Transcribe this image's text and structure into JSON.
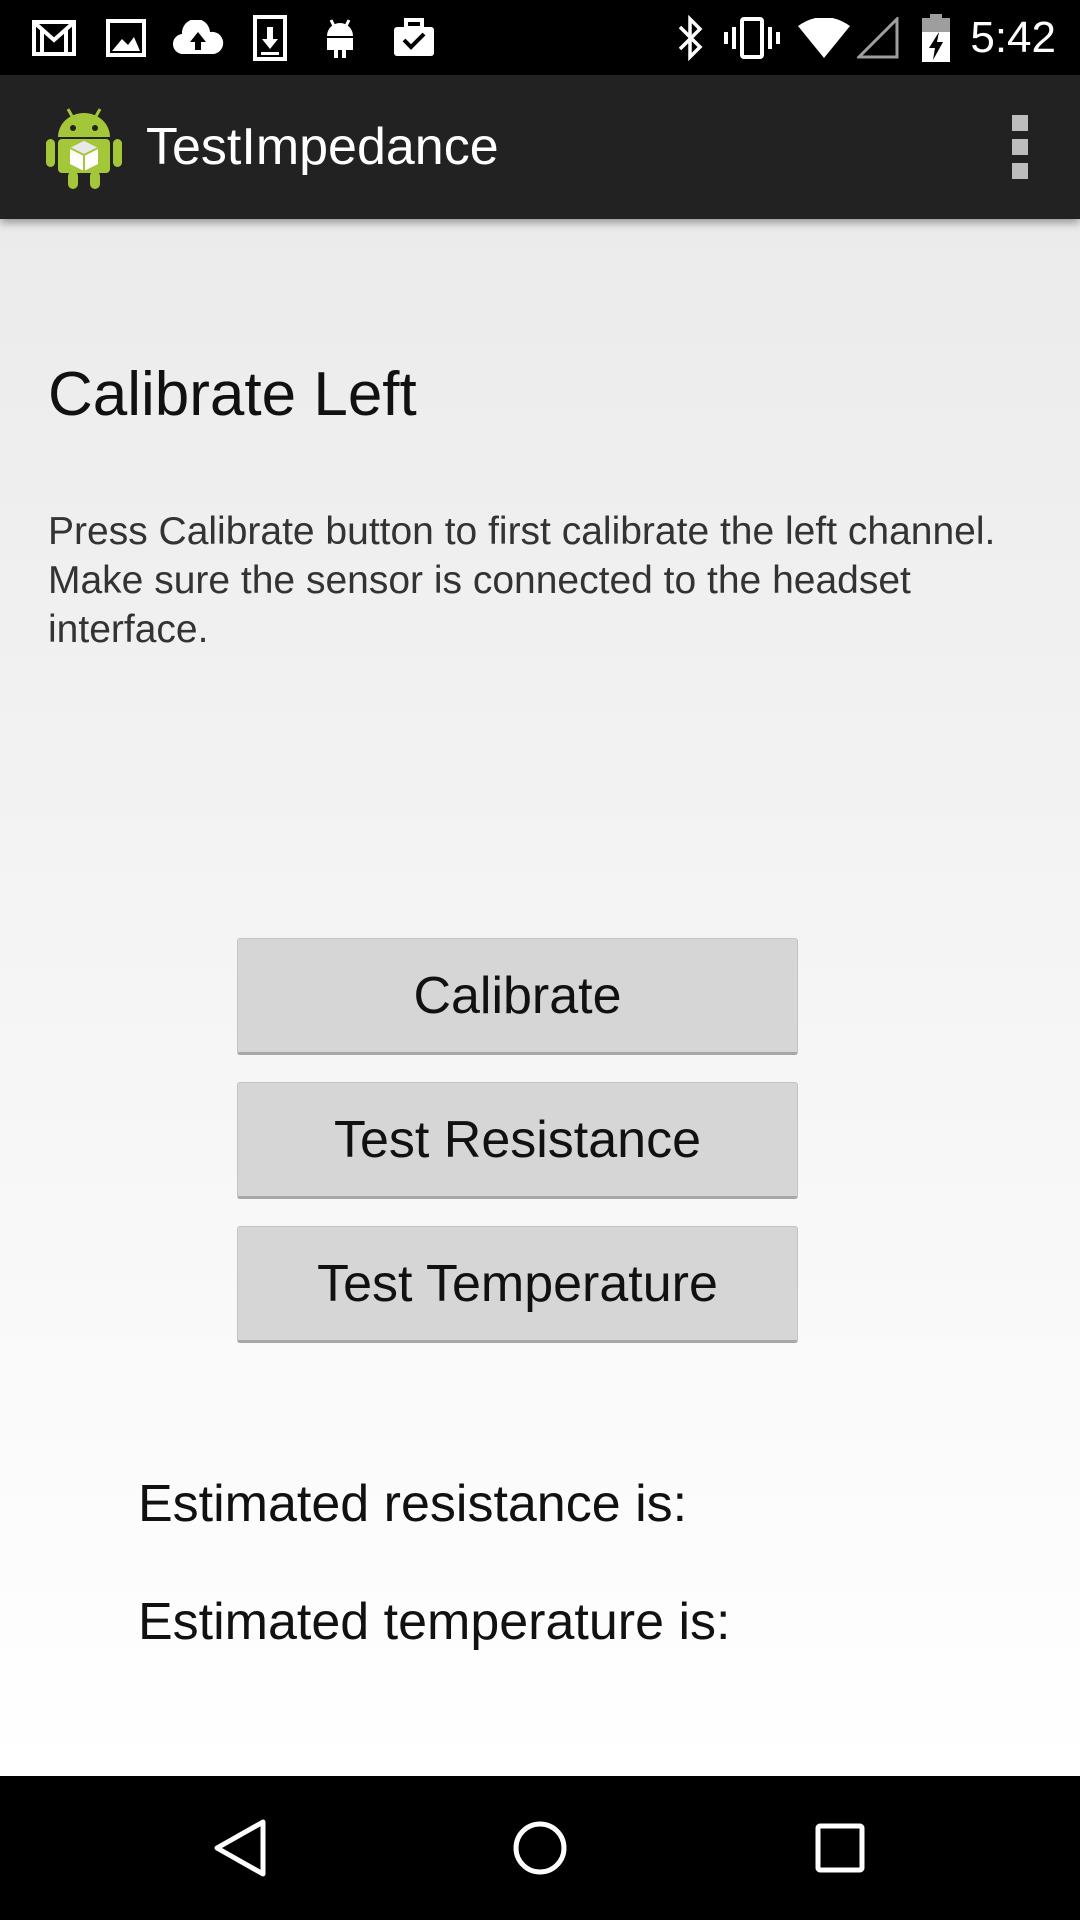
{
  "status_bar": {
    "time": "5:42",
    "icons": [
      "gmail-icon",
      "image-icon",
      "cloud-upload-icon",
      "download-icon",
      "android-icon",
      "briefcase-check-icon",
      "bluetooth-icon",
      "vibrate-icon",
      "wifi-icon",
      "signal-icon",
      "battery-charging-icon"
    ]
  },
  "action_bar": {
    "title": "TestImpedance",
    "app_icon": "android-app-icon",
    "overflow_icon": "overflow-menu-icon"
  },
  "main": {
    "heading": "Calibrate Left",
    "instructions": "Press Calibrate button to first calibrate the left channel. Make sure the sensor is connected to the headset interface.",
    "buttons": {
      "calibrate": "Calibrate",
      "test_resistance": "Test Resistance",
      "test_temperature": "Test Temperature"
    },
    "results": {
      "resistance": "Estimated resistance is:",
      "temperature": "Estimated temperature is:"
    }
  },
  "nav_bar": {
    "icons": [
      "back-icon",
      "home-icon",
      "recents-icon"
    ]
  },
  "colors": {
    "status_bar_bg": "#000000",
    "action_bar_bg": "#222222",
    "button_bg": "#d6d6d6",
    "content_bg_top": "#ebebeb",
    "content_bg_bottom": "#ffffff",
    "android_green": "#a4c639"
  }
}
